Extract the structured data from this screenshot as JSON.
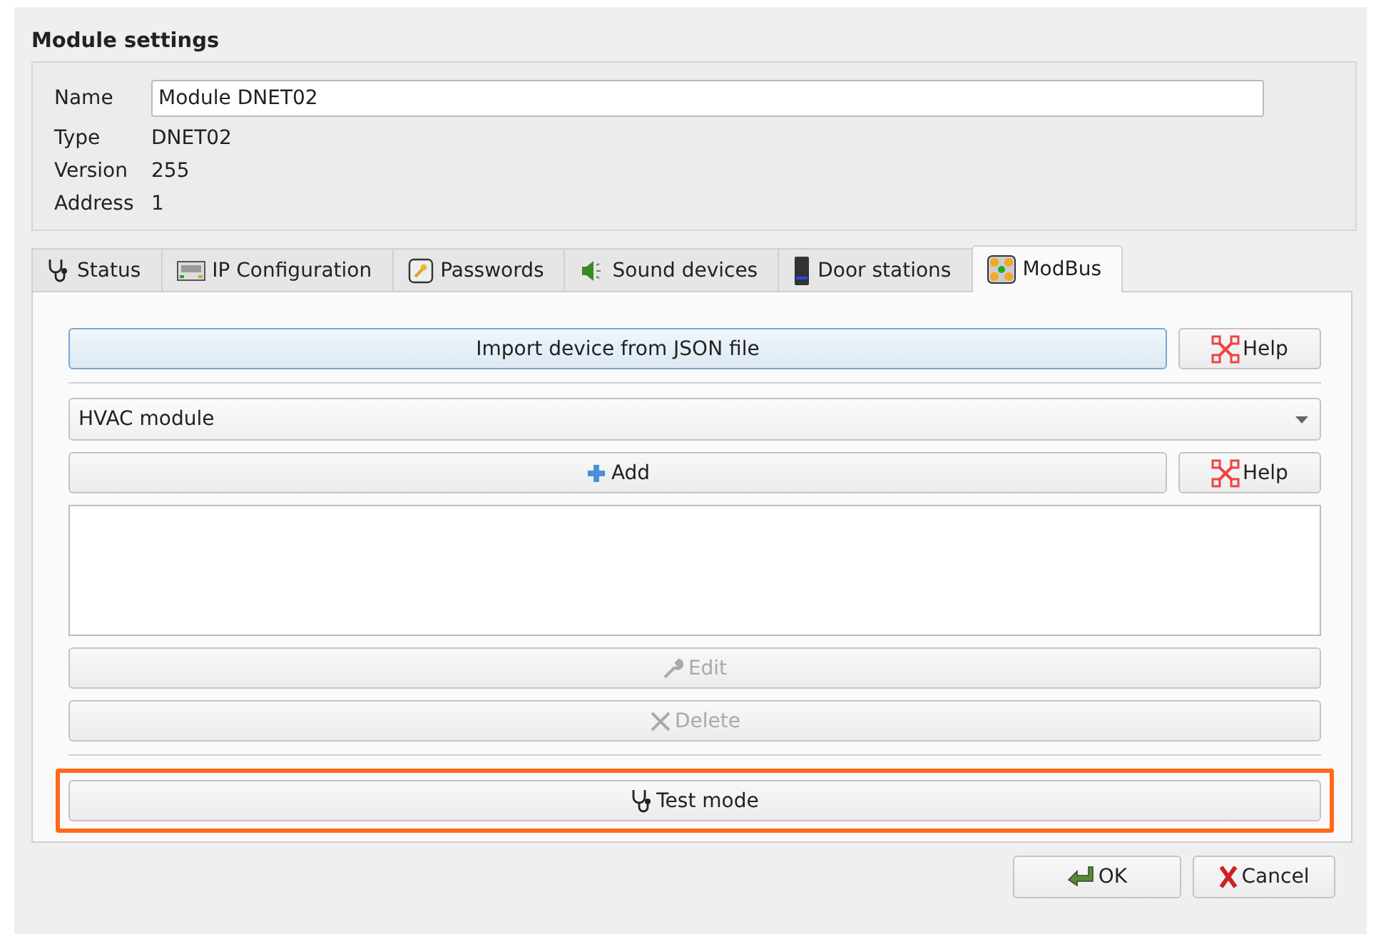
{
  "window": {
    "title": "Module settings"
  },
  "module": {
    "fields": [
      {
        "label": "Name",
        "value": "Module DNET02",
        "kind": "input"
      },
      {
        "label": "Type",
        "value": "DNET02",
        "kind": "text"
      },
      {
        "label": "Version",
        "value": "255",
        "kind": "text"
      },
      {
        "label": "Address",
        "value": "1",
        "kind": "text"
      }
    ]
  },
  "tabs": [
    {
      "label": "Status",
      "kind": "status",
      "selected": false
    },
    {
      "label": "IP Configuration",
      "kind": "ip",
      "selected": false
    },
    {
      "label": "Passwords",
      "kind": "passwords",
      "selected": false
    },
    {
      "label": "Sound devices",
      "kind": "sound",
      "selected": false
    },
    {
      "label": "Door stations",
      "kind": "door",
      "selected": false
    },
    {
      "label": "ModBus",
      "kind": "modbus",
      "selected": true
    }
  ],
  "modbus": {
    "import_button": {
      "label": "Import device from JSON file"
    },
    "import_help": {
      "label": "Help"
    },
    "device_type": {
      "value": "HVAC module"
    },
    "add_button": {
      "label": "Add"
    },
    "add_help": {
      "label": "Help"
    },
    "edit_button": {
      "label": "Edit",
      "disabled": true
    },
    "delete_button": {
      "label": "Delete",
      "disabled": true
    },
    "test_mode_button": {
      "label": "Test mode",
      "highlighted": true
    }
  },
  "buttons": [
    {
      "label": "OK",
      "kind": "ok"
    },
    {
      "label": "Cancel",
      "kind": "cancel"
    }
  ]
}
